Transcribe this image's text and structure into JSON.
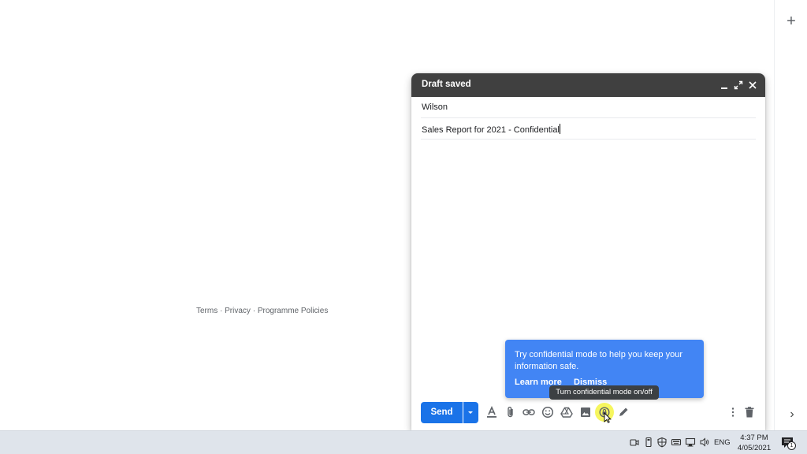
{
  "compose": {
    "title": "Draft saved",
    "to_value": "Wilson",
    "subject_value": "Sales Report for 2021 - Confidential",
    "send_label": "Send"
  },
  "promo": {
    "text": "Try confidential mode to help you keep your information safe.",
    "learn_more": "Learn more",
    "dismiss": "Dismiss"
  },
  "tooltip": {
    "text": "Turn confidential mode on/off"
  },
  "footer": {
    "terms": "Terms",
    "privacy": "Privacy",
    "policies": "Programme Policies",
    "separator": "·"
  },
  "side_panel": {
    "add_glyph": "+",
    "expand_glyph": "›"
  },
  "taskbar": {
    "language": "ENG",
    "time": "4:37 PM",
    "date": "4/05/2021",
    "notification_count": "1"
  },
  "colors": {
    "send_blue": "#1a73e8",
    "promo_blue": "#4285f4",
    "header_dark": "#404040",
    "icon_gray": "#5f6368",
    "highlight_yellow": "#f5f542"
  },
  "icons": {
    "toolbar": [
      "format-text-icon",
      "attach-icon",
      "link-icon",
      "emoji-icon",
      "drive-icon",
      "photo-icon",
      "confidential-lock-icon",
      "signature-pen-icon",
      "more-options-icon",
      "trash-icon"
    ],
    "header": [
      "minimize-icon",
      "fullscreen-icon",
      "close-icon"
    ],
    "tray": [
      "meet-icon",
      "usb-icon",
      "security-shield-icon",
      "keyboard-icon",
      "network-icon",
      "volume-icon",
      "notifications-icon"
    ]
  }
}
